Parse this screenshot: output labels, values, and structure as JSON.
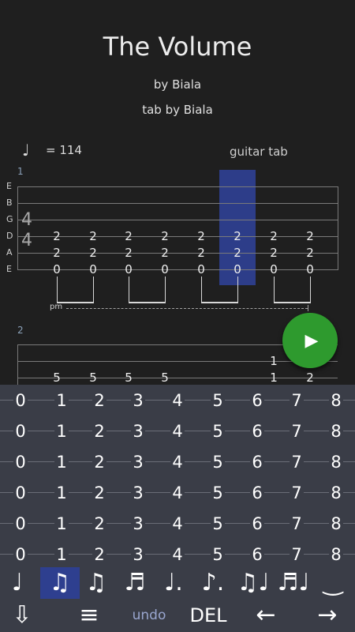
{
  "song": {
    "title": "The Volume",
    "artist": "by Biala",
    "tab_author": "tab by Biala"
  },
  "tempo": {
    "note_icon": "quarter-note-icon",
    "note_glyph": "♩",
    "text": "= 114"
  },
  "track": {
    "name": "guitar tab"
  },
  "measures": [
    {
      "number": "1"
    },
    {
      "number": "2"
    }
  ],
  "strings": [
    "E",
    "B",
    "G",
    "D",
    "A",
    "E"
  ],
  "time_signature": {
    "top": "4",
    "bottom": "4"
  },
  "measure1": {
    "beats": [
      {
        "d": "2",
        "a": "2",
        "e": "0"
      },
      {
        "d": "2",
        "a": "2",
        "e": "0"
      },
      {
        "d": "2",
        "a": "2",
        "e": "0"
      },
      {
        "d": "2",
        "a": "2",
        "e": "0"
      },
      {
        "d": "2",
        "a": "2",
        "e": "0"
      },
      {
        "d": "2",
        "a": "2",
        "e": "0"
      },
      {
        "d": "2",
        "a": "2",
        "e": "0"
      },
      {
        "d": "2",
        "a": "2",
        "e": "0"
      }
    ],
    "palm_mute": "pm"
  },
  "measure2": {
    "beats": [
      {
        "g": "",
        "b": "5"
      },
      {
        "g": "",
        "b": "5"
      },
      {
        "g": "",
        "b": "5"
      },
      {
        "g": "",
        "b": "5"
      },
      {
        "g": "1",
        "b": "1"
      },
      {
        "g": "",
        "b": "2"
      }
    ]
  },
  "keyboard": {
    "rows": [
      [
        "0",
        "1",
        "2",
        "3",
        "4",
        "5",
        "6",
        "7",
        "8"
      ],
      [
        "0",
        "1",
        "2",
        "3",
        "4",
        "5",
        "6",
        "7",
        "8"
      ],
      [
        "0",
        "1",
        "2",
        "3",
        "4",
        "5",
        "6",
        "7",
        "8"
      ],
      [
        "0",
        "1",
        "2",
        "3",
        "4",
        "5",
        "6",
        "7",
        "8"
      ],
      [
        "0",
        "1",
        "2",
        "3",
        "4",
        "5",
        "6",
        "7",
        "8"
      ],
      [
        "0",
        "1",
        "2",
        "3",
        "4",
        "5",
        "6",
        "7",
        "8"
      ]
    ],
    "durations": [
      {
        "icon": "quarter-note-icon",
        "glyph": "♩"
      },
      {
        "icon": "eighth-notes-icon",
        "glyph": "♫"
      },
      {
        "icon": "eighth-notes-icon",
        "glyph": "♫"
      },
      {
        "icon": "sixteenth-notes-icon",
        "glyph": "♬"
      },
      {
        "icon": "dotted-quarter-icon",
        "glyph": "♩."
      },
      {
        "icon": "dotted-eighth-icon",
        "glyph": "♪."
      },
      {
        "icon": "triplet-icon",
        "glyph": "♫♩"
      },
      {
        "icon": "sixteenth-triplet-icon",
        "glyph": "♬♩"
      },
      {
        "icon": "tie-icon",
        "glyph": "‿"
      }
    ],
    "selected_duration": 1,
    "tools": {
      "down_glyph": "⇩",
      "menu_glyph": "≡",
      "undo_label": "undo",
      "delete_label": "DEL",
      "left_glyph": "←",
      "right_glyph": "→"
    }
  },
  "colors": {
    "background": "#1f1f1f",
    "cursor": "#2e3f8f",
    "play": "#2e9a2e",
    "keyboard": "#3a3d47"
  }
}
